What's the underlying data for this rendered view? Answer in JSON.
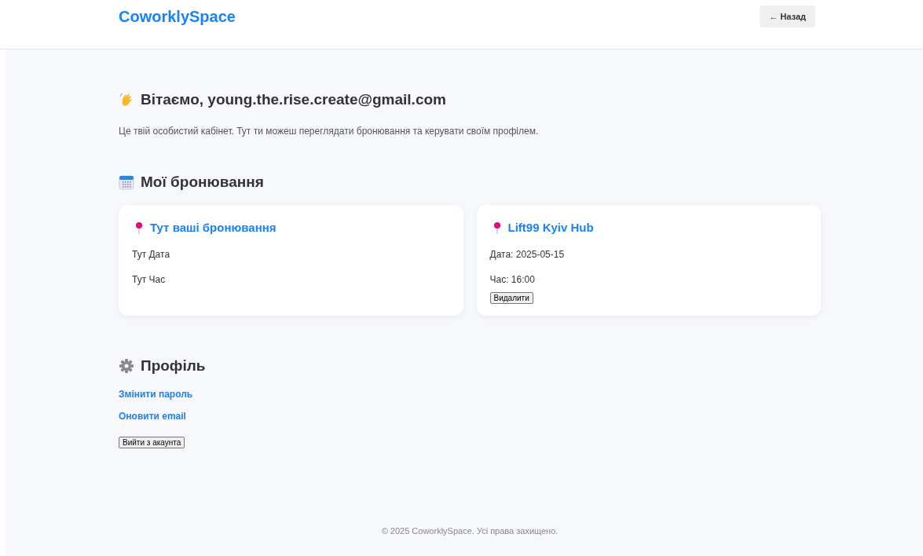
{
  "header": {
    "logo": "CoworklySpace",
    "back_button": "← Назад"
  },
  "greeting": {
    "title": "Вітаємо, young.the.rise.create@gmail.com",
    "text": "Це твій особистий кабінет. Тут ти можеш переглядати бронювання та керувати своїм профілем."
  },
  "bookings": {
    "title": "Мої бронювання",
    "cards": [
      {
        "name": "Тут ваші бронювання",
        "date": "Тут Дата",
        "time": "Тут Час"
      },
      {
        "name": "Lift99 Kyiv Hub",
        "date": "Дата: 2025-05-15",
        "time": "Час: 16:00",
        "delete_button": "Видалити"
      }
    ]
  },
  "profile": {
    "title": "Профіль",
    "links": [
      "Змінити пароль",
      "Оновити email"
    ],
    "logout_button": "Вийти з акаунта"
  },
  "footer": "© 2025 CoworklySpace. Усі права захищено."
}
